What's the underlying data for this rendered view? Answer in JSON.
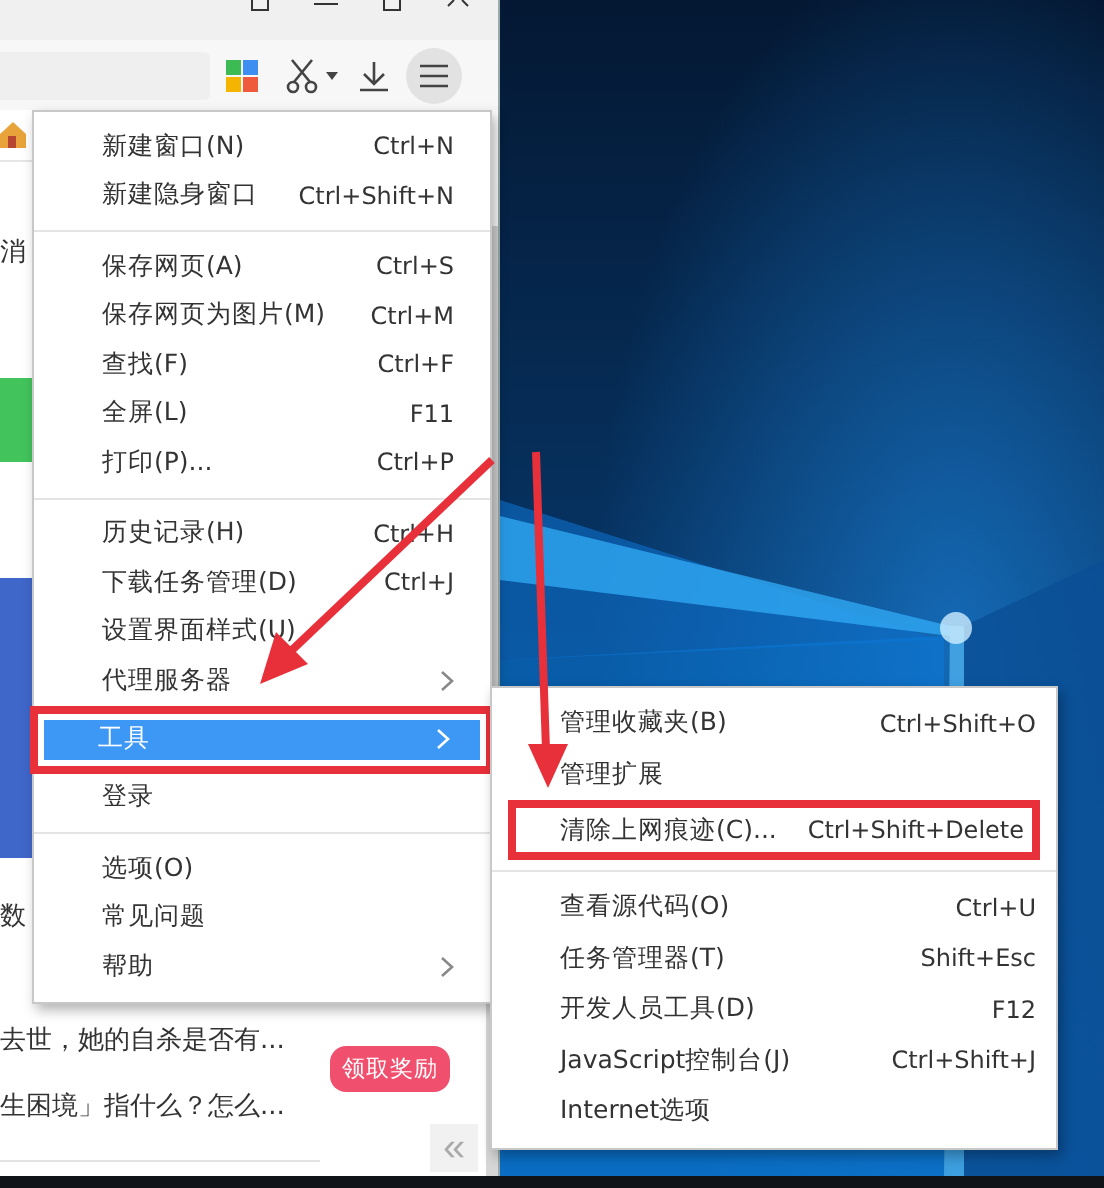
{
  "page": {
    "snippets": [
      {
        "text": "消"
      },
      {
        "text": "数"
      },
      {
        "text": "去世，她的自杀是否有..."
      },
      {
        "text": "生困境」指什么？怎么..."
      }
    ],
    "badge": "领取奖励",
    "collapse": "«"
  },
  "menu": {
    "items": [
      {
        "kind": "item",
        "label": "新建窗口(N)",
        "shortcut": "Ctrl+N",
        "has_submenu": false,
        "selected": false,
        "annotated": false
      },
      {
        "kind": "item",
        "label": "新建隐身窗口",
        "shortcut": "Ctrl+Shift+N",
        "has_submenu": false,
        "selected": false,
        "annotated": false
      },
      {
        "kind": "divider"
      },
      {
        "kind": "item",
        "label": "保存网页(A)",
        "shortcut": "Ctrl+S",
        "has_submenu": false,
        "selected": false,
        "annotated": false
      },
      {
        "kind": "item",
        "label": "保存网页为图片(M)",
        "shortcut": "Ctrl+M",
        "has_submenu": false,
        "selected": false,
        "annotated": false
      },
      {
        "kind": "item",
        "label": "查找(F)",
        "shortcut": "Ctrl+F",
        "has_submenu": false,
        "selected": false,
        "annotated": false
      },
      {
        "kind": "item",
        "label": "全屏(L)",
        "shortcut": "F11",
        "has_submenu": false,
        "selected": false,
        "annotated": false
      },
      {
        "kind": "item",
        "label": "打印(P)...",
        "shortcut": "Ctrl+P",
        "has_submenu": false,
        "selected": false,
        "annotated": false
      },
      {
        "kind": "divider"
      },
      {
        "kind": "item",
        "label": "历史记录(H)",
        "shortcut": "Ctrl+H",
        "has_submenu": false,
        "selected": false,
        "annotated": false
      },
      {
        "kind": "item",
        "label": "下载任务管理(D)",
        "shortcut": "Ctrl+J",
        "has_submenu": false,
        "selected": false,
        "annotated": false
      },
      {
        "kind": "item",
        "label": "设置界面样式(U)",
        "has_submenu": false,
        "selected": false,
        "annotated": false
      },
      {
        "kind": "item",
        "label": "代理服务器",
        "has_submenu": true,
        "selected": false,
        "annotated": false
      },
      {
        "kind": "item",
        "label": "工具",
        "has_submenu": true,
        "selected": true,
        "annotated": true
      },
      {
        "kind": "item",
        "label": "登录",
        "has_submenu": false,
        "selected": false,
        "annotated": false
      },
      {
        "kind": "divider"
      },
      {
        "kind": "item",
        "label": "选项(O)",
        "has_submenu": false,
        "selected": false,
        "annotated": false
      },
      {
        "kind": "item",
        "label": "常见问题",
        "has_submenu": false,
        "selected": false,
        "annotated": false
      },
      {
        "kind": "item",
        "label": "帮助",
        "has_submenu": true,
        "selected": false,
        "annotated": false
      }
    ]
  },
  "submenu": {
    "items": [
      {
        "kind": "item",
        "label": "管理收藏夹(B)",
        "shortcut": "Ctrl+Shift+O",
        "annotated": false
      },
      {
        "kind": "item",
        "label": "管理扩展",
        "annotated": false
      },
      {
        "kind": "item",
        "label": "清除上网痕迹(C)...",
        "shortcut": "Ctrl+Shift+Delete",
        "annotated": true
      },
      {
        "kind": "divider"
      },
      {
        "kind": "item",
        "label": "查看源代码(O)",
        "shortcut": "Ctrl+U",
        "annotated": false
      },
      {
        "kind": "item",
        "label": "任务管理器(T)",
        "shortcut": "Shift+Esc",
        "annotated": false
      },
      {
        "kind": "item",
        "label": "开发人员工具(D)",
        "shortcut": "F12",
        "annotated": false
      },
      {
        "kind": "item",
        "label": "JavaScript控制台(J)",
        "shortcut": "Ctrl+Shift+J",
        "annotated": false
      },
      {
        "kind": "item",
        "label": "Internet选项",
        "annotated": false
      }
    ]
  }
}
